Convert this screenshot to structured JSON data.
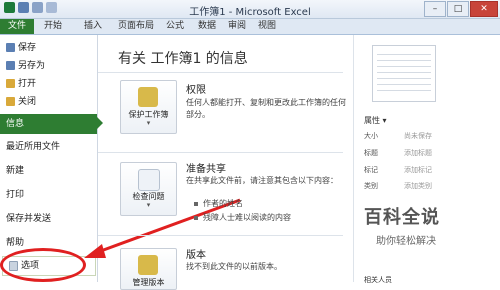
{
  "titlebar": {
    "title": "工作簿1 - Microsoft Excel",
    "minimize": "–",
    "maximize": "□",
    "close": "✕"
  },
  "ribbon_tabs": [
    "文件",
    "开始",
    "插入",
    "页面布局",
    "公式",
    "数据",
    "审阅",
    "视图"
  ],
  "sidebar": {
    "items": [
      {
        "label": "保存",
        "icon": "save-icon",
        "color": "#5b7fb3"
      },
      {
        "label": "另存为",
        "icon": "save-as-icon",
        "color": "#5b7fb3"
      },
      {
        "label": "打开",
        "icon": "folder-open-icon",
        "color": "#d9a93a"
      },
      {
        "label": "关闭",
        "icon": "close-file-icon",
        "color": "#d9a93a"
      }
    ],
    "big_items": [
      "信息",
      "最近所用文件",
      "新建",
      "打印",
      "保存并发送",
      "帮助"
    ],
    "options_label": "选项",
    "active_color": "#2e7d32"
  },
  "main": {
    "title": "有关 工作簿1 的信息",
    "permissions": {
      "button_label": "保护工作簿",
      "button_dropdown": "▾",
      "heading": "权限",
      "text": "任何人都能打开、复制和更改此工作簿的任何部分。"
    },
    "share": {
      "button_label": "检查问题",
      "button_dropdown": "▾",
      "heading": "准备共享",
      "text": "在共享此文件前，请注意其包含以下内容：",
      "bullets": [
        "作者的姓名",
        "残障人士难以阅读的内容"
      ]
    },
    "versions": {
      "button_label": "管理版本",
      "heading": "版本",
      "text": "找不到此文件的以前版本。"
    }
  },
  "properties": {
    "heading": "属性 ▾",
    "rows": [
      {
        "label": "大小",
        "value": "尚未保存"
      },
      {
        "label": "标题",
        "value": "添加标题"
      },
      {
        "label": "标记",
        "value": "添加标记"
      },
      {
        "label": "类别",
        "value": "添加类别"
      }
    ],
    "related_people": "相关人员"
  },
  "watermark": {
    "line1": "百科全说",
    "line2": "助你轻松解决"
  },
  "colors": {
    "file_tab": "#2e7d32",
    "annotation_red": "#e02020"
  }
}
